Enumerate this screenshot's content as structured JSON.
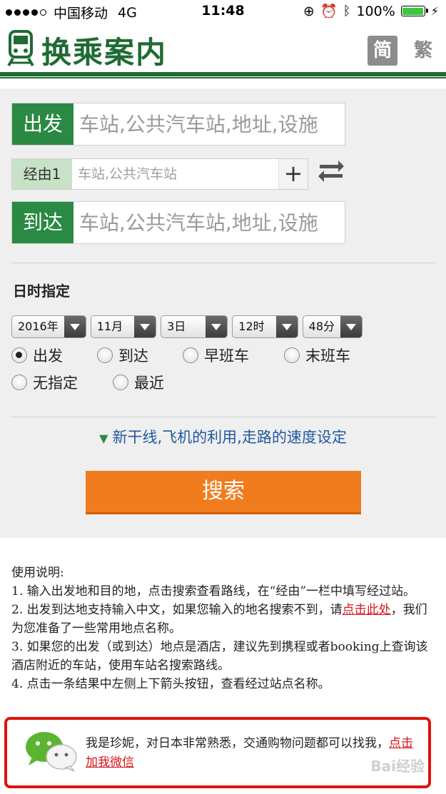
{
  "status_bar": {
    "carrier": "中国移动",
    "network": "4G",
    "time": "11:48",
    "battery_percent": "100%"
  },
  "header": {
    "title": "换乘案内",
    "lang_simplified": "简",
    "lang_traditional": "繁"
  },
  "form": {
    "departure_label": "出发",
    "departure_placeholder": "车站,公共汽车站,地址,设施",
    "via_label": "经由1",
    "via_placeholder": "车站,公共汽车站",
    "add_via": "+",
    "arrival_label": "到达",
    "arrival_placeholder": "车站,公共汽车站,地址,设施"
  },
  "datetime": {
    "title": "日时指定",
    "year": "2016年",
    "month": "11月",
    "day": "3日",
    "hour": "12时",
    "minute": "48分",
    "options": {
      "depart": "出发",
      "arrive": "到达",
      "first_train": "早班车",
      "last_train": "末班车",
      "unspecified": "无指定",
      "recent": "最近"
    },
    "selected": "depart"
  },
  "advanced_link": "新干线,飞机的利用,走路的速度设定",
  "search_button": "搜索",
  "instructions": {
    "heading": "使用说明:",
    "item1": "1. 输入出发地和目的地，点击搜索查看路线，在“经由”一栏中填写经过站。",
    "item2_pre": "2. 出发到达地支持输入中文，如果您输入的地名搜索不到，请",
    "item2_link": "点击此处",
    "item2_post": "，我们为您准备了一些常用地点名称。",
    "item3": "3. 如果您的出发（或到达）地点是酒店，建议先到携程或者booking上查询该酒店附近的车站，使用车站名搜索路线。",
    "item4": "4. 点击一条结果中左侧上下箭头按钮，查看经过站点名称。"
  },
  "wechat": {
    "text": "我是珍妮，对日本非常熟悉，交通购物问题都可以找我，",
    "link": "点击加我微信"
  },
  "watermark": "Bai经验",
  "colors": {
    "brand_green": "#1f6b33",
    "label_green": "#2a8a43",
    "search_orange": "#f07c1e",
    "link_red": "#d4141b",
    "link_blue": "#1e5aa0",
    "highlight_red": "#e0120e"
  }
}
